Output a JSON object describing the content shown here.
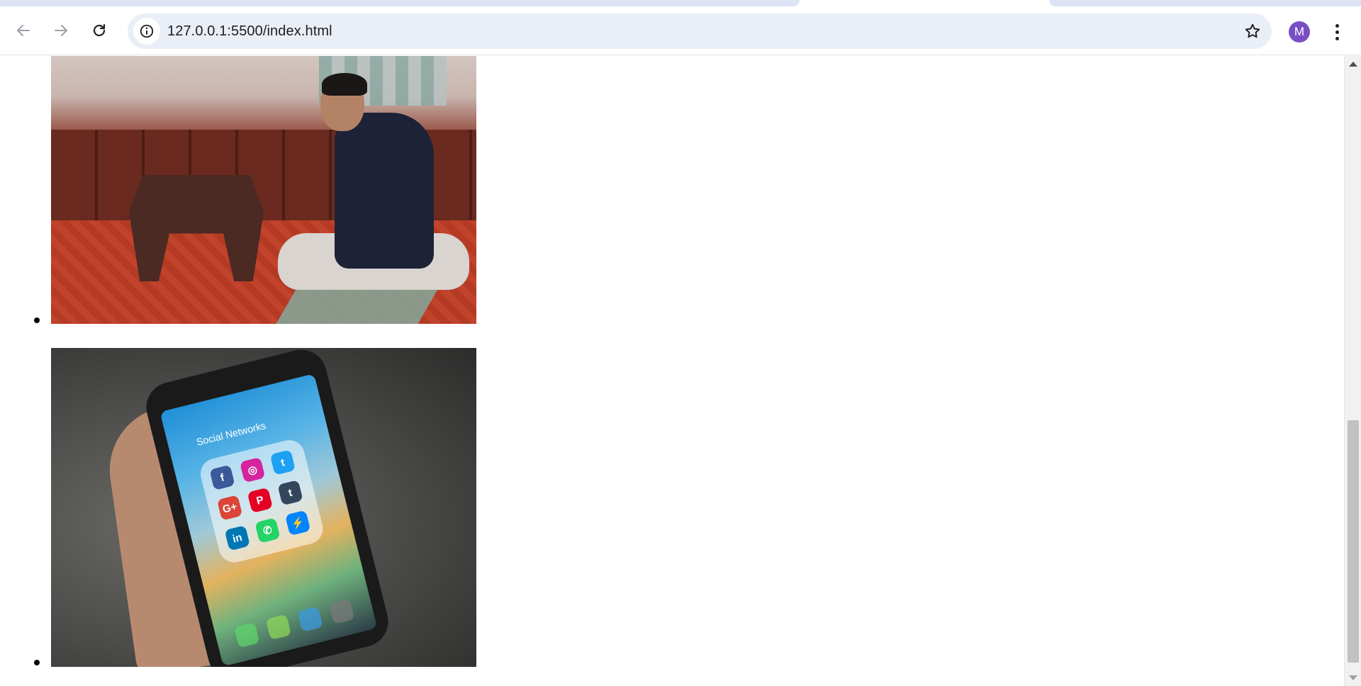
{
  "browser": {
    "url_host": "127.0.0.1",
    "url_rest": ":5500/index.html",
    "profile_initial": "M",
    "colors": {
      "avatar": "#7b4fc4",
      "omnibox": "#e9eef7",
      "tab_inactive": "#dde3f5"
    },
    "icons": {
      "back": "arrow-left-icon",
      "forward": "arrow-right-icon",
      "reload": "reload-icon",
      "site_info": "info-icon",
      "bookmark": "star-icon",
      "menu": "kebab-menu-icon"
    }
  },
  "page": {
    "gallery": [
      {
        "kind": "photo",
        "subject": "man-praying"
      },
      {
        "kind": "photo",
        "subject": "phone-social-apps",
        "screen_text": "Social Networks",
        "apps": [
          {
            "glyph": "f",
            "color": "#3b5998"
          },
          {
            "glyph": "◎",
            "color": "#d6249f"
          },
          {
            "glyph": "t",
            "color": "#1da1f2"
          },
          {
            "glyph": "G+",
            "color": "#db4437"
          },
          {
            "glyph": "P",
            "color": "#e60023"
          },
          {
            "glyph": "t",
            "color": "#35465c"
          },
          {
            "glyph": "in",
            "color": "#0077b5"
          },
          {
            "glyph": "✆",
            "color": "#25d366"
          },
          {
            "glyph": "⚡",
            "color": "#0084ff"
          }
        ]
      }
    ]
  }
}
